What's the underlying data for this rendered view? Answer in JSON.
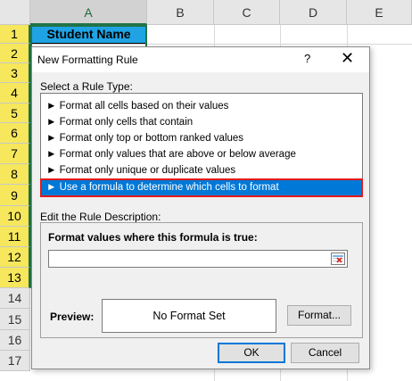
{
  "spreadsheet": {
    "columns": [
      "A",
      "B",
      "C",
      "D",
      "E"
    ],
    "rows": [
      "1",
      "2",
      "3",
      "4",
      "5",
      "6",
      "7",
      "8",
      "9",
      "10",
      "11",
      "12",
      "13",
      "14",
      "15",
      "16",
      "17"
    ],
    "cell_a1": "Student Name"
  },
  "dialog": {
    "title": "New Formatting Rule",
    "help": "?",
    "close": "✕",
    "select_label": "Select a Rule Type:",
    "rule_types": [
      "► Format all cells based on their values",
      "► Format only cells that contain",
      "► Format only top or bottom ranked values",
      "► Format only values that are above or below average",
      "► Format only unique or duplicate values",
      "► Use a formula to determine which cells to format"
    ],
    "edit_label": "Edit the Rule Description:",
    "formula_label": "Format values where this formula is true:",
    "formula_value": "",
    "preview_label": "Preview:",
    "preview_text": "No Format Set",
    "format_button": "Format...",
    "ok_button": "OK",
    "cancel_button": "Cancel"
  },
  "colors": {
    "header_fill": "#1fa3e4",
    "selection_blue": "#0078d7",
    "highlight_red": "#e31a1a",
    "row_header_selected": "#f6e75c"
  }
}
